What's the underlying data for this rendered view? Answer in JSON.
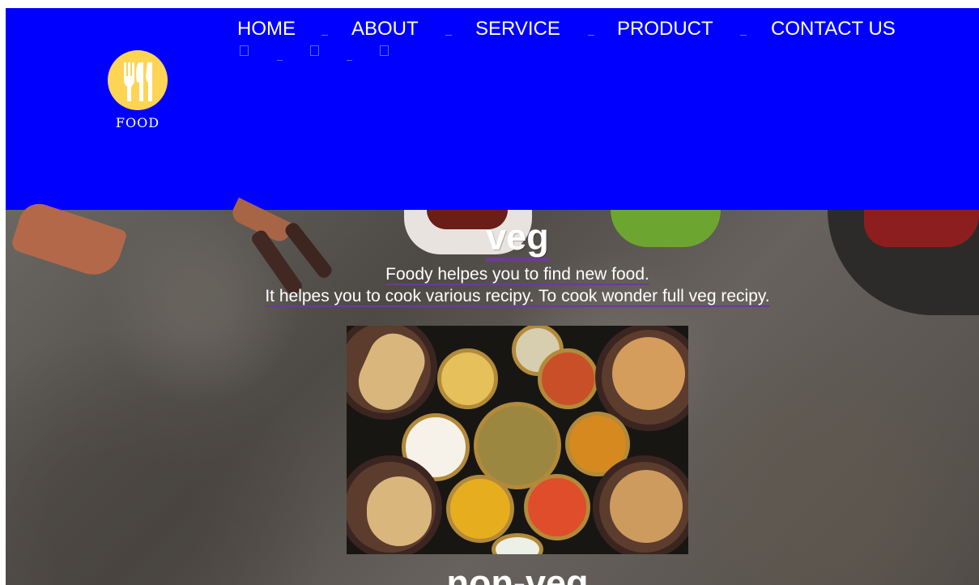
{
  "header": {
    "logo": {
      "text": "FOOD",
      "icon": "fork-knife-icon",
      "colors": {
        "circle": "#fed454",
        "icon": "#ffffff"
      }
    },
    "nav": [
      {
        "label": "HOME"
      },
      {
        "label": "ABOUT"
      },
      {
        "label": "SERVICE"
      },
      {
        "label": "PRODUCT"
      },
      {
        "label": "CONTACT US"
      }
    ]
  },
  "hero": {
    "title": "veg",
    "line1": "Foody helpes you to find new food.",
    "line2": "It helpes you to cook various recipy. To cook wonder full veg recipy.",
    "image": {
      "name": "veg-food-platter"
    },
    "next_title": "non-veg"
  },
  "colors": {
    "header_bg": "#0000ff",
    "text": "#ffffff",
    "link_underline": "#6c3c8e"
  }
}
